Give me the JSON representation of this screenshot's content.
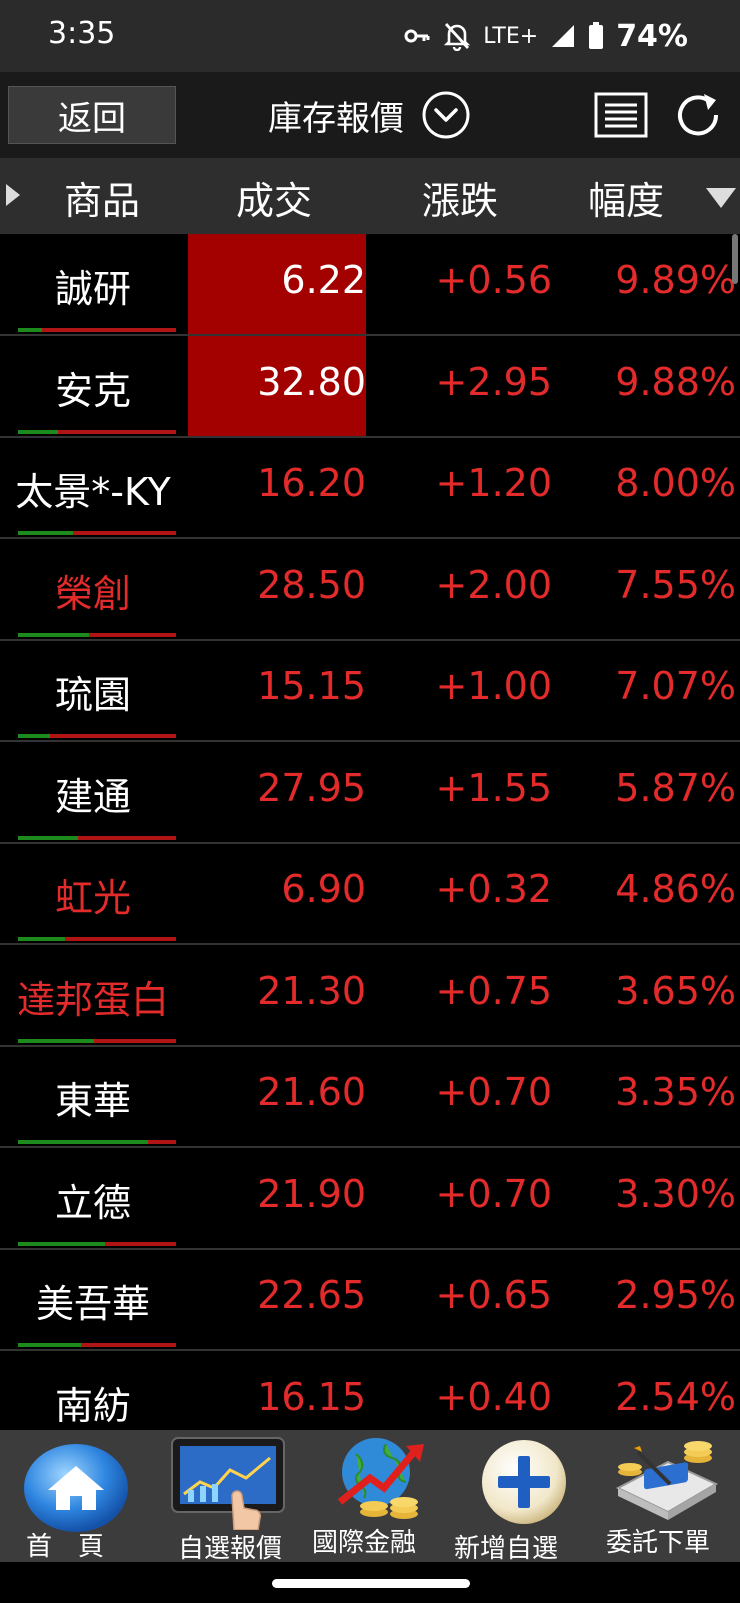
{
  "status": {
    "time": "3:35",
    "network": "LTE+",
    "battery": "74%"
  },
  "header": {
    "back_label": "返回",
    "title": "庫存報價"
  },
  "columns": {
    "product": "商品",
    "price": "成交",
    "change": "漲跌",
    "percent": "幅度"
  },
  "rows": [
    {
      "name": "誠研",
      "price": "6.22",
      "change": "+0.56",
      "percent": "9.89%",
      "name_color": "white",
      "price_highlight": true,
      "bar_green": 0.15
    },
    {
      "name": "安克",
      "price": "32.80",
      "change": "+2.95",
      "percent": "9.88%",
      "name_color": "white",
      "price_highlight": true,
      "bar_green": 0.25
    },
    {
      "name": "太景*-KY",
      "price": "16.20",
      "change": "+1.20",
      "percent": "8.00%",
      "name_color": "white",
      "price_highlight": false,
      "bar_green": 0.35
    },
    {
      "name": "榮創",
      "price": "28.50",
      "change": "+2.00",
      "percent": "7.55%",
      "name_color": "red",
      "price_highlight": false,
      "bar_green": 0.45
    },
    {
      "name": "琉園",
      "price": "15.15",
      "change": "+1.00",
      "percent": "7.07%",
      "name_color": "white",
      "price_highlight": false,
      "bar_green": 0.2
    },
    {
      "name": "建通",
      "price": "27.95",
      "change": "+1.55",
      "percent": "5.87%",
      "name_color": "white",
      "price_highlight": false,
      "bar_green": 0.38
    },
    {
      "name": "虹光",
      "price": "6.90",
      "change": "+0.32",
      "percent": "4.86%",
      "name_color": "red",
      "price_highlight": false,
      "bar_green": 0.3
    },
    {
      "name": "達邦蛋白",
      "price": "21.30",
      "change": "+0.75",
      "percent": "3.65%",
      "name_color": "red",
      "price_highlight": false,
      "bar_green": 0.48
    },
    {
      "name": "東華",
      "price": "21.60",
      "change": "+0.70",
      "percent": "3.35%",
      "name_color": "white",
      "price_highlight": false,
      "bar_green": 0.82
    },
    {
      "name": "立德",
      "price": "21.90",
      "change": "+0.70",
      "percent": "3.30%",
      "name_color": "white",
      "price_highlight": false,
      "bar_green": 0.55
    },
    {
      "name": "美吾華",
      "price": "22.65",
      "change": "+0.65",
      "percent": "2.95%",
      "name_color": "white",
      "price_highlight": false,
      "bar_green": 0.4
    },
    {
      "name": "南紡",
      "price": "16.15",
      "change": "+0.40",
      "percent": "2.54%",
      "name_color": "white",
      "price_highlight": false,
      "bar_green": 0.3
    }
  ],
  "tabs": [
    {
      "label": "首　頁",
      "icon": "home-icon"
    },
    {
      "label": "自選報價",
      "icon": "tablet-chart-icon"
    },
    {
      "label": "國際金融",
      "icon": "globe-coins-icon"
    },
    {
      "label": "新增自選",
      "icon": "plus-icon"
    },
    {
      "label": "委託下單",
      "icon": "order-coins-icon"
    }
  ],
  "colors": {
    "up_red": "#e32b2b",
    "highlight_bg": "#a30000",
    "bar_green": "#1c8a1c",
    "bar_red": "#b01414"
  }
}
